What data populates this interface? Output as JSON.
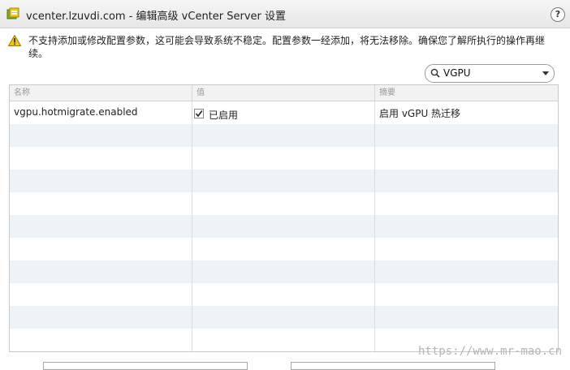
{
  "window": {
    "title": "vcenter.lzuvdi.com - 编辑高级 vCenter Server 设置",
    "help_label": "?"
  },
  "warning": {
    "text": "不支持添加或修改配置参数，这可能会导致系统不稳定。配置参数一经添加，将无法移除。确保您了解所执行的操作再继续。"
  },
  "search": {
    "value": "VGPU"
  },
  "table": {
    "columns": [
      "名称",
      "值",
      "摘要"
    ],
    "rows": [
      {
        "name": "vgpu.hotmigrate.enabled",
        "value_checked": true,
        "value_label": "已启用",
        "summary": "启用 vGPU 热迁移"
      }
    ]
  },
  "watermark": "https://www.mr-mao.cn",
  "colors": {
    "alt_row": "#eef3f7",
    "header_bg": "#f2f2f2",
    "warning_yellow": "#f3c515",
    "title_icon": "#7cae2d"
  },
  "icons": {
    "title": "vcenter-settings-icon",
    "warning": "warning-triangle-icon",
    "search": "search-icon",
    "dropdown": "chevron-down-icon"
  }
}
